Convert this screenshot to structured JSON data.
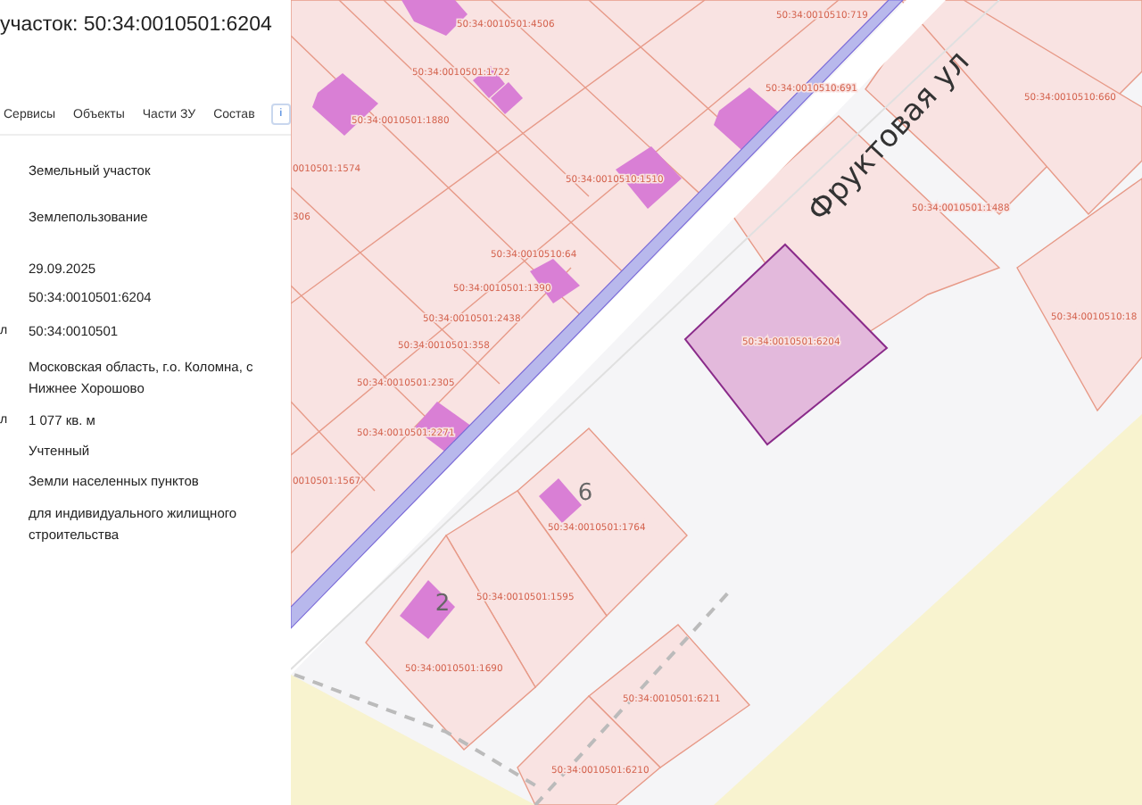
{
  "panel": {
    "title": "участок: 50:34:0010501:6204",
    "tabs": [
      {
        "label": "Сервисы"
      },
      {
        "label": "Объекты"
      },
      {
        "label": "Части ЗУ"
      },
      {
        "label": "Состав"
      }
    ],
    "info_button": "i",
    "rows": [
      {
        "value": "Земельный участок"
      },
      {
        "value": "Землепользование"
      },
      {
        "value": "29.09.2025"
      },
      {
        "value": "50:34:0010501:6204"
      },
      {
        "label": "л",
        "value": "50:34:0010501"
      },
      {
        "value": "Московская область, г.о. Коломна, с Нижнее Хорошово"
      },
      {
        "label": "л",
        "value": "1 077 кв. м"
      },
      {
        "value": "Учтенный"
      },
      {
        "value": "Земли населенных пунктов"
      },
      {
        "value": "для индивидуального жилищного строительства"
      }
    ]
  },
  "map": {
    "street": "Фруктовая ул",
    "house_numbers": [
      "6",
      "2"
    ],
    "parcels": [
      "50:34:0010501:4506",
      "50:34:0010510:719",
      "50:34:0010501:1722",
      "50:34:0010501:1880",
      "50:34:0010510:691",
      "50:34:0010510:660",
      "0010501:1574",
      "306",
      "50:34:0010510:1510",
      "50:34:0010501:1488",
      "50:34:0010510:64",
      "50:34:0010501:1390",
      "50:34:0010501:2438",
      "50:34:0010510:18",
      "50:34:0010501:6204",
      "50:34:0010501:358",
      "50:34:0010501:2305",
      "50:34:0010501:2271",
      "0010501:1567",
      "50:34:0010501:1764",
      "50:34:0010501:1595",
      "50:34:0010501:1690",
      "50:34:0010501:6211",
      "50:34:0010501:6210"
    ]
  }
}
